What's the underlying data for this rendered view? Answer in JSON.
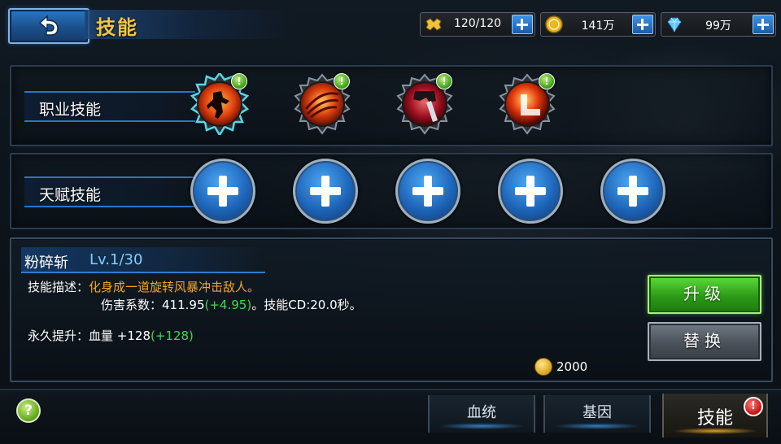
{
  "header": {
    "title": "技能",
    "back_icon": "back-arrow-icon",
    "resources": [
      {
        "name": "stamina",
        "icon": "stamina-icon",
        "value": "120/120"
      },
      {
        "name": "gold",
        "icon": "gold-coin-icon",
        "value": "141万"
      },
      {
        "name": "diamond",
        "icon": "diamond-icon",
        "value": "99万"
      }
    ]
  },
  "class_skills": {
    "label": "职业技能",
    "skills": [
      {
        "icon": "shadow-warrior-skill-icon",
        "selected": true,
        "notify": true
      },
      {
        "icon": "whirlwind-slash-skill-icon",
        "selected": false,
        "notify": true
      },
      {
        "icon": "masked-assassin-skill-icon",
        "selected": false,
        "notify": true
      },
      {
        "icon": "flame-strike-skill-icon",
        "selected": false,
        "notify": true
      }
    ]
  },
  "talent_skills": {
    "label": "天赋技能",
    "slots": 5,
    "slot_icon": "plus-icon"
  },
  "detail": {
    "name": "粉碎斩",
    "level": "Lv.1/30",
    "desc_label": "技能描述：",
    "desc_text": "化身成一道旋转风暴冲击敌人。",
    "damage_label": "伤害系数：",
    "damage_value": "411.95",
    "damage_bonus": "(+4.95)",
    "cd_text": "。技能CD:20.0秒。",
    "perm_label": "永久提升：",
    "perm_text": "血量 +128",
    "perm_bonus": "(+128)",
    "upgrade_label": "升级",
    "replace_label": "替换",
    "cost": "2000"
  },
  "bottom": {
    "help_label": "?",
    "tabs": [
      "血统",
      "基因"
    ],
    "active_tab": "技能",
    "active_badge": "!"
  },
  "colors": {
    "title": "#f3c640",
    "accent_blue": "#2e74c4",
    "orange_text": "#f5a623",
    "green_text": "#3ddc4a",
    "upgrade_green": "#2d9b17"
  }
}
